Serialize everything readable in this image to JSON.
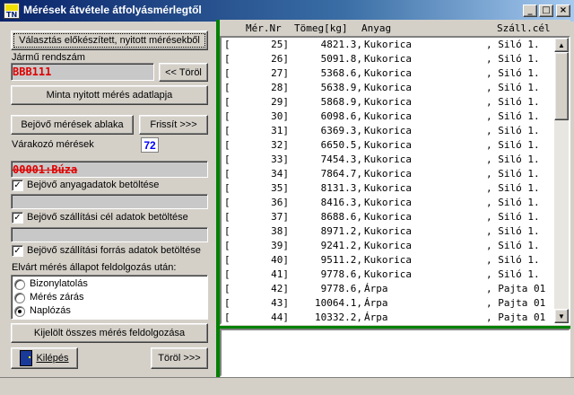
{
  "window": {
    "title": "Mérések átvétele átfolyásmérlegtől",
    "icon_text": "TN",
    "controls": [
      "_",
      "□",
      "×"
    ]
  },
  "left": {
    "select_button": "Választás előkészített, nyitott mérésekből",
    "plate_label": "Jármű rendszám",
    "plate_value": "BBB111",
    "clear_button": "<< Töröl",
    "sample_button": "Minta nyitott mérés adatlapja",
    "incoming_button": "Bejövő mérések ablaka",
    "refresh_button": "Frissít >>>",
    "waiting_label": "Várakozó mérések",
    "waiting_count": "72",
    "material_value": "00001:Búza",
    "chk1_label": "Bejövő anyagadatok betöltése",
    "chk2_label": "Bejövő szállítási cél adatok betöltése",
    "chk3_label": "Bejövő szállítási forrás adatok betöltése",
    "expected_label": "Elvárt mérés állapot feldolgozás után:",
    "radio_options": [
      "Bizonylatolás",
      "Mérés zárás",
      "Naplózás"
    ],
    "radio_selected": 2,
    "process_button": "Kijelölt összes mérés feldolgozása",
    "exit_button": "Kilépés",
    "delete_button": "Töröl >>>"
  },
  "list": {
    "headers": [
      "Mér.Nr",
      "Tömeg[kg]",
      "Anyag",
      "Száll.cél"
    ],
    "rows": [
      {
        "nr": "25]",
        "weight": "4821.3,",
        "material": "Kukorica",
        "dest": ", Siló 1."
      },
      {
        "nr": "26]",
        "weight": "5091.8,",
        "material": "Kukorica",
        "dest": ", Siló 1."
      },
      {
        "nr": "27]",
        "weight": "5368.6,",
        "material": "Kukorica",
        "dest": ", Siló 1."
      },
      {
        "nr": "28]",
        "weight": "5638.9,",
        "material": "Kukorica",
        "dest": ", Siló 1."
      },
      {
        "nr": "29]",
        "weight": "5868.9,",
        "material": "Kukorica",
        "dest": ", Siló 1."
      },
      {
        "nr": "30]",
        "weight": "6098.6,",
        "material": "Kukorica",
        "dest": ", Siló 1."
      },
      {
        "nr": "31]",
        "weight": "6369.3,",
        "material": "Kukorica",
        "dest": ", Siló 1."
      },
      {
        "nr": "32]",
        "weight": "6650.5,",
        "material": "Kukorica",
        "dest": ", Siló 1."
      },
      {
        "nr": "33]",
        "weight": "7454.3,",
        "material": "Kukorica",
        "dest": ", Siló 1."
      },
      {
        "nr": "34]",
        "weight": "7864.7,",
        "material": "Kukorica",
        "dest": ", Siló 1."
      },
      {
        "nr": "35]",
        "weight": "8131.3,",
        "material": "Kukorica",
        "dest": ", Siló 1."
      },
      {
        "nr": "36]",
        "weight": "8416.3,",
        "material": "Kukorica",
        "dest": ", Siló 1."
      },
      {
        "nr": "37]",
        "weight": "8688.6,",
        "material": "Kukorica",
        "dest": ", Siló 1."
      },
      {
        "nr": "38]",
        "weight": "8971.2,",
        "material": "Kukorica",
        "dest": ", Siló 1."
      },
      {
        "nr": "39]",
        "weight": "9241.2,",
        "material": "Kukorica",
        "dest": ", Siló 1."
      },
      {
        "nr": "40]",
        "weight": "9511.2,",
        "material": "Kukorica",
        "dest": ", Siló 1."
      },
      {
        "nr": "41]",
        "weight": "9778.6,",
        "material": "Kukorica",
        "dest": ", Siló 1."
      },
      {
        "nr": "42]",
        "weight": "9778.6,",
        "material": "Árpa",
        "dest": ", Pajta 01"
      },
      {
        "nr": "43]",
        "weight": "10064.1,",
        "material": "Árpa",
        "dest": ", Pajta 01"
      },
      {
        "nr": "44]",
        "weight": "10332.2,",
        "material": "Árpa",
        "dest": ", Pajta 01"
      }
    ]
  },
  "colors": {
    "title_start": "#0a246a",
    "accent_green": "#008000",
    "red_text": "#e00000",
    "blue_count": "#0000ff"
  }
}
